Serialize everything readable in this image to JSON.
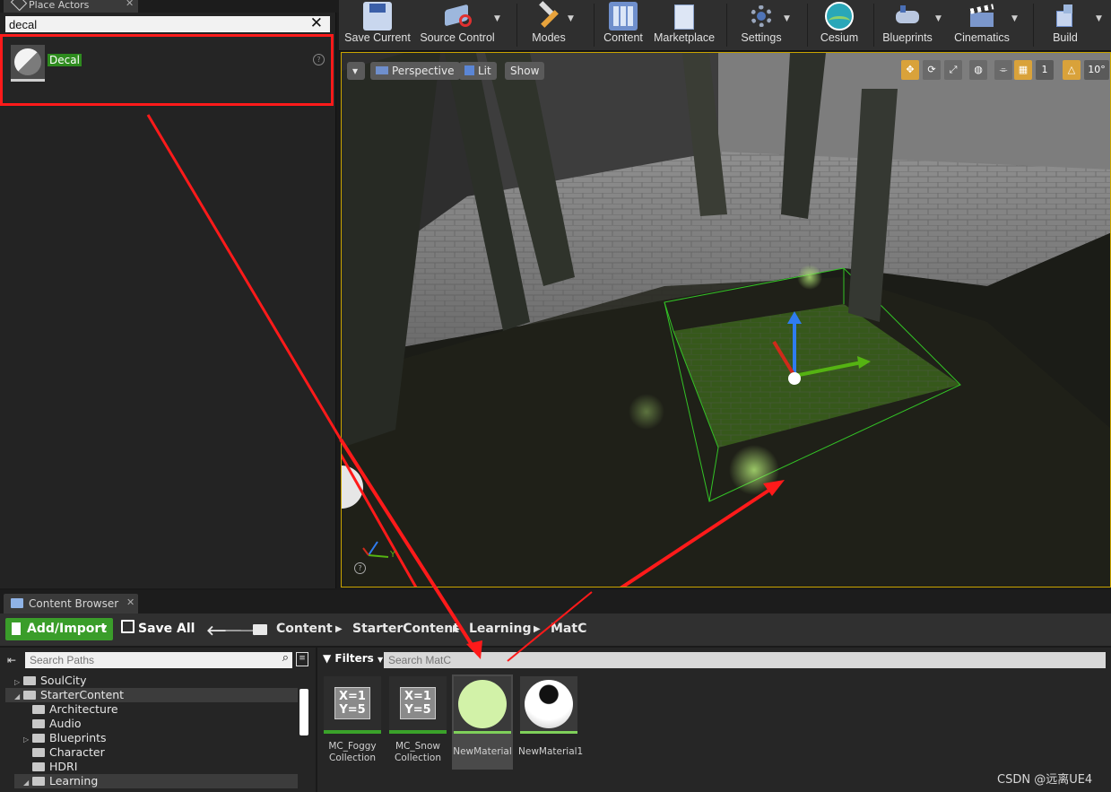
{
  "place_actors": {
    "tab_label": "Place Actors",
    "search_value": "decal",
    "result_label": "Decal"
  },
  "toolbar": {
    "buttons": [
      {
        "label": "Save Current"
      },
      {
        "label": "Source Control"
      },
      {
        "label": "Modes"
      },
      {
        "label": "Content"
      },
      {
        "label": "Marketplace"
      },
      {
        "label": "Settings"
      },
      {
        "label": "Cesium"
      },
      {
        "label": "Blueprints"
      },
      {
        "label": "Cinematics"
      },
      {
        "label": "Build"
      }
    ]
  },
  "viewport": {
    "perspective_label": "Perspective",
    "lit_label": "Lit",
    "show_label": "Show",
    "grid_value": "1",
    "angle_value": "10°",
    "axis_label_y": "Y"
  },
  "content_browser": {
    "tab_label": "Content Browser",
    "add_import_label": "Add/Import",
    "save_all_label": "Save All",
    "breadcrumb": [
      "Content",
      "StarterContent",
      "Learning",
      "MatC"
    ],
    "search_paths_placeholder": "Search Paths",
    "filters_label": "Filters",
    "search_assets_placeholder": "Search MatC",
    "tree": [
      {
        "label": "SoulCity",
        "expanded": false
      },
      {
        "label": "StarterContent",
        "expanded": true
      },
      {
        "label": "Architecture",
        "expanded": false
      },
      {
        "label": "Audio",
        "expanded": false
      },
      {
        "label": "Blueprints",
        "expanded": false
      },
      {
        "label": "Character",
        "expanded": false
      },
      {
        "label": "HDRI",
        "expanded": false
      },
      {
        "label": "Learning",
        "expanded": true
      }
    ],
    "assets": [
      {
        "name_line1": "MC_Foggy",
        "name_line2": "Collection",
        "card": [
          "X=1",
          "Y=5"
        ]
      },
      {
        "name_line1": "MC_Snow",
        "name_line2": "Collection",
        "card": [
          "X=1",
          "Y=5"
        ]
      },
      {
        "name_line1": "NewMaterial",
        "name_line2": ""
      },
      {
        "name_line1": "NewMaterial1",
        "name_line2": ""
      }
    ]
  },
  "watermark": "CSDN @远离UE4",
  "colors": {
    "highlight_red": "#ff1a1a",
    "accent_green": "#3a9d2a",
    "viewport_border": "#c9a400"
  }
}
